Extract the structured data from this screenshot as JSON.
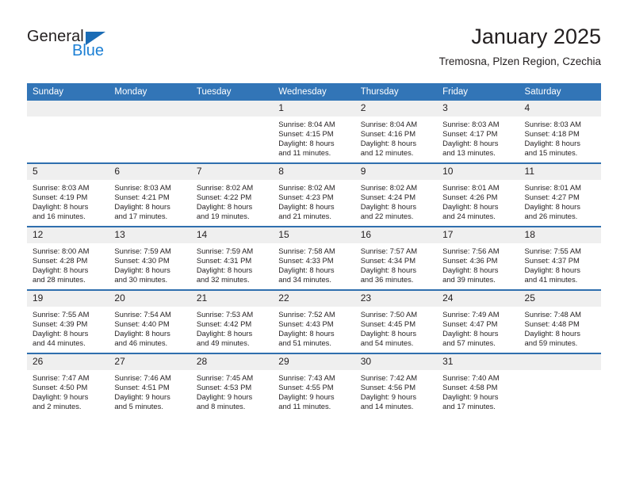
{
  "brand": {
    "name_top": "General",
    "name_bottom": "Blue",
    "triangle_color": "#1b6cb5",
    "blue_color": "#1b7fd4"
  },
  "header": {
    "title": "January 2025",
    "subtitle": "Tremosna, Plzen Region, Czechia"
  },
  "theme": {
    "header_bg": "#3275b7",
    "row_divider": "#2f6fae",
    "daynum_bg": "#efefef",
    "text": "#231f20"
  },
  "calendar": {
    "weekday_headers": [
      "Sunday",
      "Monday",
      "Tuesday",
      "Wednesday",
      "Thursday",
      "Friday",
      "Saturday"
    ],
    "weeks": [
      [
        {
          "day": "",
          "blank": true,
          "sunrise": "",
          "sunset": "",
          "daylight_1": "",
          "daylight_2": ""
        },
        {
          "day": "",
          "blank": true,
          "sunrise": "",
          "sunset": "",
          "daylight_1": "",
          "daylight_2": ""
        },
        {
          "day": "",
          "blank": true,
          "sunrise": "",
          "sunset": "",
          "daylight_1": "",
          "daylight_2": ""
        },
        {
          "day": "1",
          "blank": false,
          "sunrise": "Sunrise: 8:04 AM",
          "sunset": "Sunset: 4:15 PM",
          "daylight_1": "Daylight: 8 hours",
          "daylight_2": "and 11 minutes."
        },
        {
          "day": "2",
          "blank": false,
          "sunrise": "Sunrise: 8:04 AM",
          "sunset": "Sunset: 4:16 PM",
          "daylight_1": "Daylight: 8 hours",
          "daylight_2": "and 12 minutes."
        },
        {
          "day": "3",
          "blank": false,
          "sunrise": "Sunrise: 8:03 AM",
          "sunset": "Sunset: 4:17 PM",
          "daylight_1": "Daylight: 8 hours",
          "daylight_2": "and 13 minutes."
        },
        {
          "day": "4",
          "blank": false,
          "sunrise": "Sunrise: 8:03 AM",
          "sunset": "Sunset: 4:18 PM",
          "daylight_1": "Daylight: 8 hours",
          "daylight_2": "and 15 minutes."
        }
      ],
      [
        {
          "day": "5",
          "blank": false,
          "sunrise": "Sunrise: 8:03 AM",
          "sunset": "Sunset: 4:19 PM",
          "daylight_1": "Daylight: 8 hours",
          "daylight_2": "and 16 minutes."
        },
        {
          "day": "6",
          "blank": false,
          "sunrise": "Sunrise: 8:03 AM",
          "sunset": "Sunset: 4:21 PM",
          "daylight_1": "Daylight: 8 hours",
          "daylight_2": "and 17 minutes."
        },
        {
          "day": "7",
          "blank": false,
          "sunrise": "Sunrise: 8:02 AM",
          "sunset": "Sunset: 4:22 PM",
          "daylight_1": "Daylight: 8 hours",
          "daylight_2": "and 19 minutes."
        },
        {
          "day": "8",
          "blank": false,
          "sunrise": "Sunrise: 8:02 AM",
          "sunset": "Sunset: 4:23 PM",
          "daylight_1": "Daylight: 8 hours",
          "daylight_2": "and 21 minutes."
        },
        {
          "day": "9",
          "blank": false,
          "sunrise": "Sunrise: 8:02 AM",
          "sunset": "Sunset: 4:24 PM",
          "daylight_1": "Daylight: 8 hours",
          "daylight_2": "and 22 minutes."
        },
        {
          "day": "10",
          "blank": false,
          "sunrise": "Sunrise: 8:01 AM",
          "sunset": "Sunset: 4:26 PM",
          "daylight_1": "Daylight: 8 hours",
          "daylight_2": "and 24 minutes."
        },
        {
          "day": "11",
          "blank": false,
          "sunrise": "Sunrise: 8:01 AM",
          "sunset": "Sunset: 4:27 PM",
          "daylight_1": "Daylight: 8 hours",
          "daylight_2": "and 26 minutes."
        }
      ],
      [
        {
          "day": "12",
          "blank": false,
          "sunrise": "Sunrise: 8:00 AM",
          "sunset": "Sunset: 4:28 PM",
          "daylight_1": "Daylight: 8 hours",
          "daylight_2": "and 28 minutes."
        },
        {
          "day": "13",
          "blank": false,
          "sunrise": "Sunrise: 7:59 AM",
          "sunset": "Sunset: 4:30 PM",
          "daylight_1": "Daylight: 8 hours",
          "daylight_2": "and 30 minutes."
        },
        {
          "day": "14",
          "blank": false,
          "sunrise": "Sunrise: 7:59 AM",
          "sunset": "Sunset: 4:31 PM",
          "daylight_1": "Daylight: 8 hours",
          "daylight_2": "and 32 minutes."
        },
        {
          "day": "15",
          "blank": false,
          "sunrise": "Sunrise: 7:58 AM",
          "sunset": "Sunset: 4:33 PM",
          "daylight_1": "Daylight: 8 hours",
          "daylight_2": "and 34 minutes."
        },
        {
          "day": "16",
          "blank": false,
          "sunrise": "Sunrise: 7:57 AM",
          "sunset": "Sunset: 4:34 PM",
          "daylight_1": "Daylight: 8 hours",
          "daylight_2": "and 36 minutes."
        },
        {
          "day": "17",
          "blank": false,
          "sunrise": "Sunrise: 7:56 AM",
          "sunset": "Sunset: 4:36 PM",
          "daylight_1": "Daylight: 8 hours",
          "daylight_2": "and 39 minutes."
        },
        {
          "day": "18",
          "blank": false,
          "sunrise": "Sunrise: 7:55 AM",
          "sunset": "Sunset: 4:37 PM",
          "daylight_1": "Daylight: 8 hours",
          "daylight_2": "and 41 minutes."
        }
      ],
      [
        {
          "day": "19",
          "blank": false,
          "sunrise": "Sunrise: 7:55 AM",
          "sunset": "Sunset: 4:39 PM",
          "daylight_1": "Daylight: 8 hours",
          "daylight_2": "and 44 minutes."
        },
        {
          "day": "20",
          "blank": false,
          "sunrise": "Sunrise: 7:54 AM",
          "sunset": "Sunset: 4:40 PM",
          "daylight_1": "Daylight: 8 hours",
          "daylight_2": "and 46 minutes."
        },
        {
          "day": "21",
          "blank": false,
          "sunrise": "Sunrise: 7:53 AM",
          "sunset": "Sunset: 4:42 PM",
          "daylight_1": "Daylight: 8 hours",
          "daylight_2": "and 49 minutes."
        },
        {
          "day": "22",
          "blank": false,
          "sunrise": "Sunrise: 7:52 AM",
          "sunset": "Sunset: 4:43 PM",
          "daylight_1": "Daylight: 8 hours",
          "daylight_2": "and 51 minutes."
        },
        {
          "day": "23",
          "blank": false,
          "sunrise": "Sunrise: 7:50 AM",
          "sunset": "Sunset: 4:45 PM",
          "daylight_1": "Daylight: 8 hours",
          "daylight_2": "and 54 minutes."
        },
        {
          "day": "24",
          "blank": false,
          "sunrise": "Sunrise: 7:49 AM",
          "sunset": "Sunset: 4:47 PM",
          "daylight_1": "Daylight: 8 hours",
          "daylight_2": "and 57 minutes."
        },
        {
          "day": "25",
          "blank": false,
          "sunrise": "Sunrise: 7:48 AM",
          "sunset": "Sunset: 4:48 PM",
          "daylight_1": "Daylight: 8 hours",
          "daylight_2": "and 59 minutes."
        }
      ],
      [
        {
          "day": "26",
          "blank": false,
          "sunrise": "Sunrise: 7:47 AM",
          "sunset": "Sunset: 4:50 PM",
          "daylight_1": "Daylight: 9 hours",
          "daylight_2": "and 2 minutes."
        },
        {
          "day": "27",
          "blank": false,
          "sunrise": "Sunrise: 7:46 AM",
          "sunset": "Sunset: 4:51 PM",
          "daylight_1": "Daylight: 9 hours",
          "daylight_2": "and 5 minutes."
        },
        {
          "day": "28",
          "blank": false,
          "sunrise": "Sunrise: 7:45 AM",
          "sunset": "Sunset: 4:53 PM",
          "daylight_1": "Daylight: 9 hours",
          "daylight_2": "and 8 minutes."
        },
        {
          "day": "29",
          "blank": false,
          "sunrise": "Sunrise: 7:43 AM",
          "sunset": "Sunset: 4:55 PM",
          "daylight_1": "Daylight: 9 hours",
          "daylight_2": "and 11 minutes."
        },
        {
          "day": "30",
          "blank": false,
          "sunrise": "Sunrise: 7:42 AM",
          "sunset": "Sunset: 4:56 PM",
          "daylight_1": "Daylight: 9 hours",
          "daylight_2": "and 14 minutes."
        },
        {
          "day": "31",
          "blank": false,
          "sunrise": "Sunrise: 7:40 AM",
          "sunset": "Sunset: 4:58 PM",
          "daylight_1": "Daylight: 9 hours",
          "daylight_2": "and 17 minutes."
        },
        {
          "day": "",
          "blank": true,
          "sunrise": "",
          "sunset": "",
          "daylight_1": "",
          "daylight_2": ""
        }
      ]
    ]
  }
}
